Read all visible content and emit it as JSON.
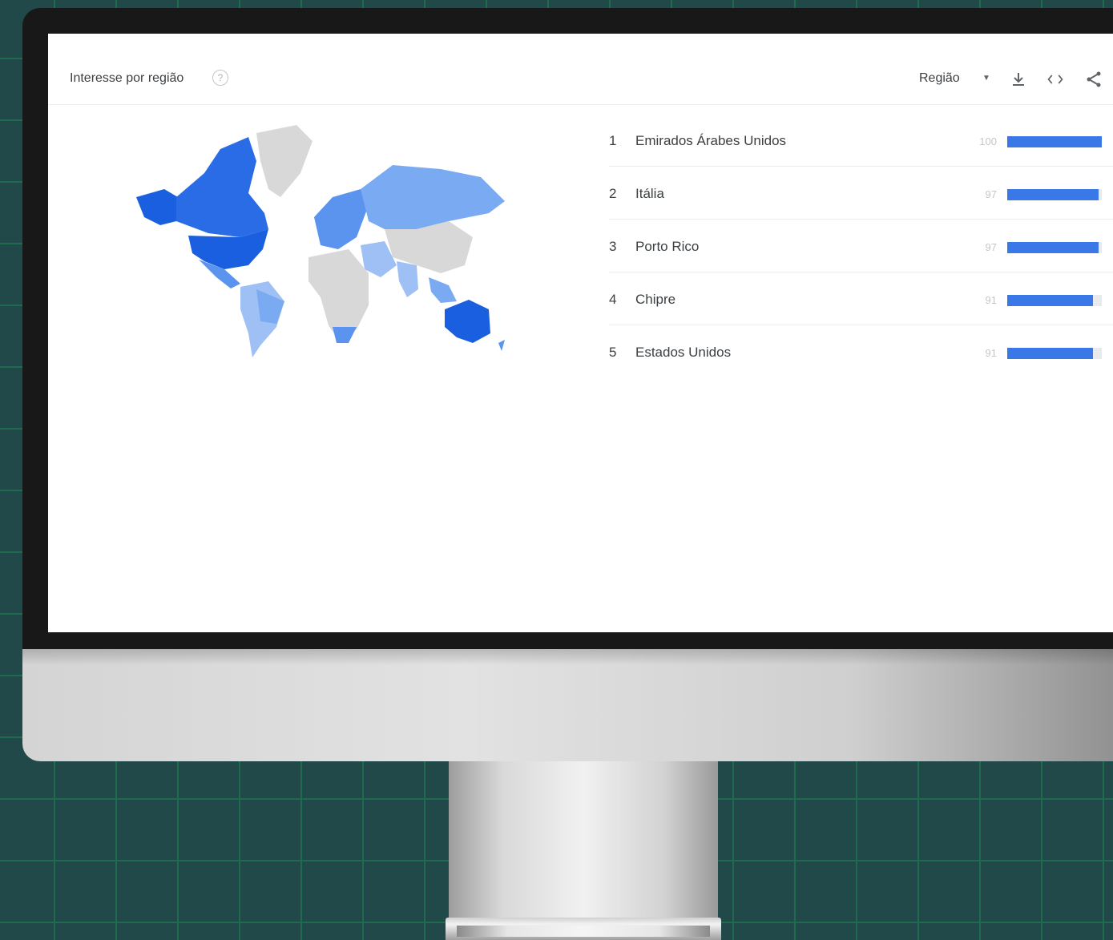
{
  "panel": {
    "title": "Interesse por região",
    "help_icon": "help-circle-icon",
    "region_label": "Região",
    "caret_icon": "caret-down-icon",
    "toolbar_icons": [
      "download-icon",
      "embed-code-icon",
      "share-icon"
    ]
  },
  "map_colors": {
    "strong": "#1a5fe0",
    "medium": "#5a94ee",
    "light": "#9ec0f5",
    "none": "#d8d8d8"
  },
  "ranking": [
    {
      "rank": "1",
      "country": "Emirados Árabes Unidos",
      "score": "100",
      "value": 100
    },
    {
      "rank": "2",
      "country": "Itália",
      "score": "97",
      "value": 97
    },
    {
      "rank": "3",
      "country": "Porto Rico",
      "score": "97",
      "value": 97
    },
    {
      "rank": "4",
      "country": "Chipre",
      "score": "91",
      "value": 91
    },
    {
      "rank": "5",
      "country": "Estados Unidos",
      "score": "91",
      "value": 91
    }
  ]
}
